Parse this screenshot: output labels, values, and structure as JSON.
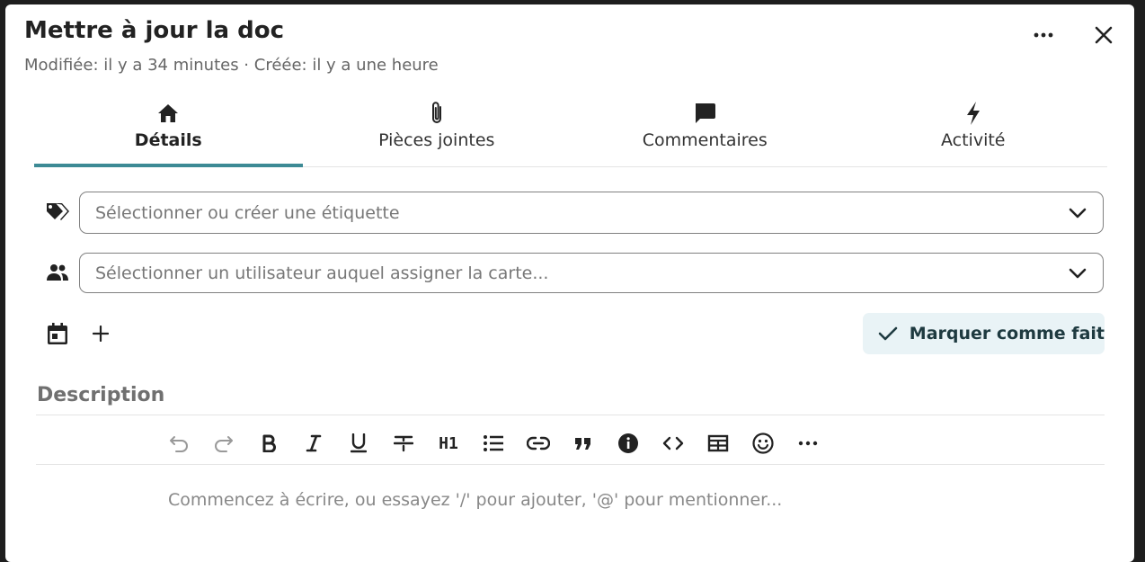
{
  "card": {
    "title": "Mettre à jour la doc",
    "subtitle": "Modifiée: il y a 34 minutes · Créée: il y a une heure"
  },
  "header_actions": {
    "more_icon": "more-horizontal-icon",
    "close_icon": "close-icon"
  },
  "tabs": [
    {
      "label": "Détails",
      "icon": "home-icon",
      "active": true
    },
    {
      "label": "Pièces jointes",
      "icon": "paperclip-icon",
      "active": false
    },
    {
      "label": "Commentaires",
      "icon": "comment-icon",
      "active": false
    },
    {
      "label": "Activité",
      "icon": "lightning-icon",
      "active": false
    }
  ],
  "tags": {
    "placeholder": "Sélectionner ou créer une étiquette",
    "icon": "tags-icon"
  },
  "assignees": {
    "placeholder": "Sélectionner un utilisateur auquel assigner la carte...",
    "icon": "users-icon"
  },
  "due_date": {
    "calendar_icon": "calendar-icon",
    "add_icon": "plus-icon"
  },
  "done_button": {
    "label": "Marquer comme fait",
    "icon": "check-icon"
  },
  "description": {
    "title": "Description",
    "placeholder": "Commencez à écrire, ou essayez '/' pour ajouter, '@' pour mentionner...",
    "toolbar": {
      "heading_label": "H1"
    }
  },
  "colors": {
    "accent": "#3d8a95",
    "done_button_bg": "#e9f3f6"
  }
}
